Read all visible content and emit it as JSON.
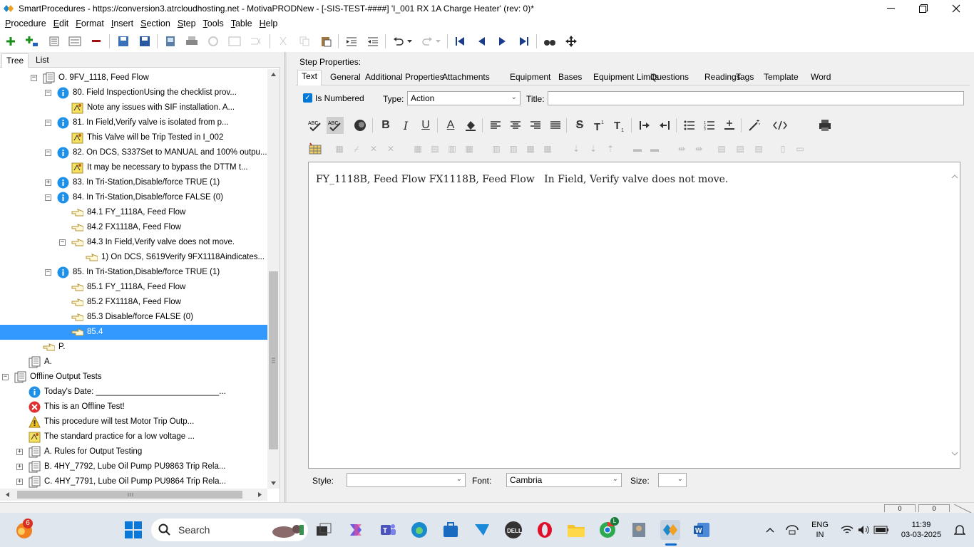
{
  "window": {
    "title": "SmartProcedures - https://conversion3.atrcloudhosting.net - MotivaPRODNew - [-SIS-TEST-####] 'I_001 RX 1A Charge Heater' (rev: 0)*"
  },
  "menu": [
    "Procedure",
    "Edit",
    "Format",
    "Insert",
    "Section",
    "Step",
    "Tools",
    "Table",
    "Help"
  ],
  "menu_underline": [
    "P",
    "E",
    "F",
    "I",
    "S",
    "S",
    "T",
    "T",
    "H"
  ],
  "left_tabs": {
    "tree": "Tree",
    "list": "List"
  },
  "tree": [
    {
      "label": "O. 9FV_1118, Feed Flow",
      "icon": "section-icon",
      "expander": "−"
    },
    {
      "label": "80. Field InspectionUsing the checklist prov...",
      "icon": "info-icon",
      "expander": "−"
    },
    {
      "label": "Note any issues with SIF installation. A...",
      "icon": "note-icon",
      "expander": ""
    },
    {
      "label": "81. In Field,Verify valve is isolated from p...",
      "icon": "info-icon",
      "expander": "−"
    },
    {
      "label": "This Valve will be Trip Tested in I_002",
      "icon": "note-icon",
      "expander": ""
    },
    {
      "label": "82. On DCS, S337Set to MANUAL and 100% outpu...",
      "icon": "info-icon",
      "expander": "−"
    },
    {
      "label": "It may be necessary to bypass the DTTM t...",
      "icon": "note-icon",
      "expander": ""
    },
    {
      "label": "83. In Tri-Station,Disable/force TRUE (1)",
      "icon": "info-icon",
      "expander": "+"
    },
    {
      "label": "84. In Tri-Station,Disable/force FALSE (0)",
      "icon": "info-icon",
      "expander": "−"
    },
    {
      "label": "84.1 FY_1118A, Feed Flow",
      "icon": "hand-icon",
      "expander": ""
    },
    {
      "label": "84.2 FX1118A, Feed Flow",
      "icon": "hand-icon",
      "expander": ""
    },
    {
      "label": "84.3 In Field,Verify valve does not move.",
      "icon": "hand-icon",
      "expander": "−"
    },
    {
      "label": "1) On DCS,  S619Verify  9FX1118Aindicates...",
      "icon": "hand-icon",
      "expander": ""
    },
    {
      "label": "85. In Tri-Station,Disable/force TRUE (1)",
      "icon": "info-icon",
      "expander": "−"
    },
    {
      "label": "85.1 FY_1118A, Feed Flow",
      "icon": "hand-icon",
      "expander": ""
    },
    {
      "label": "85.2 FX1118A, Feed Flow",
      "icon": "hand-icon",
      "expander": ""
    },
    {
      "label": "85.3 Disable/force FALSE (0)",
      "icon": "hand-icon",
      "expander": ""
    },
    {
      "label": "85.4",
      "icon": "hand-icon",
      "expander": "",
      "selected": true
    },
    {
      "label": "P.",
      "icon": "hand-icon",
      "expander": ""
    },
    {
      "label": "A.",
      "icon": "section-icon",
      "expander": ""
    },
    {
      "label": "Offline Output Tests",
      "icon": "section-icon",
      "expander": "−"
    },
    {
      "label": "Today's Date: ___________________________...",
      "icon": "info-icon",
      "expander": ""
    },
    {
      "label": "This is an Offline Test!",
      "icon": "error-icon",
      "expander": ""
    },
    {
      "label": "This procedure will test Motor Trip Outp...",
      "icon": "warning-icon",
      "expander": ""
    },
    {
      "label": "The standard practice for a low voltage ...",
      "icon": "note-icon",
      "expander": ""
    },
    {
      "label": "A. Rules for Output Testing",
      "icon": "section-icon",
      "expander": "+"
    },
    {
      "label": "B. 4HY_7792, Lube Oil Pump PU9863 Trip Rela...",
      "icon": "section-icon",
      "expander": "+"
    },
    {
      "label": "C. 4HY_7791, Lube Oil Pump PU9864 Trip Rela...",
      "icon": "section-icon",
      "expander": "+"
    }
  ],
  "step_properties": {
    "label": "Step Properties:",
    "tabs": [
      "Text",
      "General",
      "Additional Properties",
      "Attachments",
      "Equipment",
      "Bases",
      "Equipment Limits",
      "Questions",
      "Readings",
      "Tags",
      "Template",
      "Word"
    ],
    "is_numbered_label": "Is Numbered",
    "type_label": "Type:",
    "type_value": "Action",
    "title_label": "Title:",
    "title_value": "",
    "editor_text": "FY_1118B, Feed Flow FX1118B, Feed Flow   In Field, Verify valve does not move.",
    "style_label": "Style:",
    "style_value": "",
    "font_label": "Font:",
    "font_value": "Cambria",
    "size_label": "Size:",
    "size_value": ""
  },
  "taskbar": {
    "search_placeholder": "Search",
    "notification_count": "6",
    "chrome_badge": "L",
    "lang_line1": "ENG",
    "lang_line2": "IN",
    "time": "11:39",
    "date": "03-03-2025"
  }
}
